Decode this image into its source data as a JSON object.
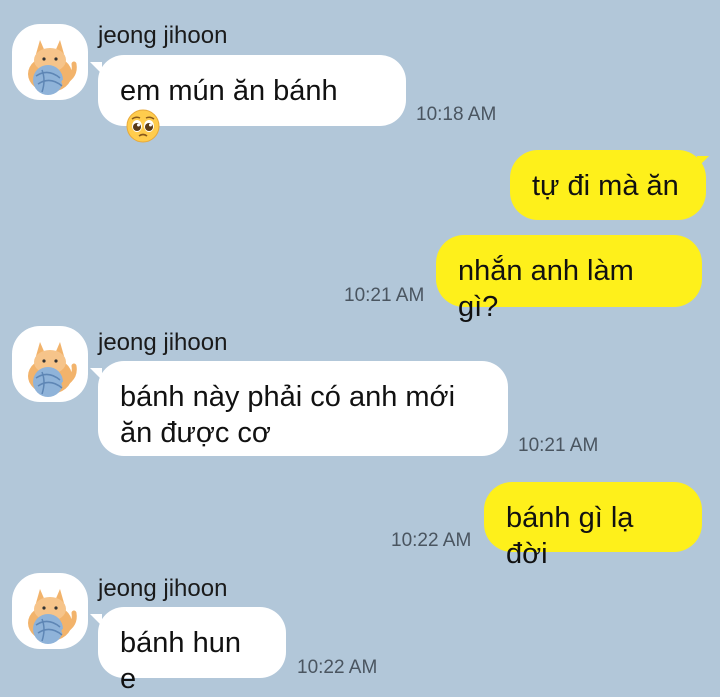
{
  "sender_name": "jeong jihoon",
  "messages": [
    {
      "direction": "in",
      "text": "em mún ăn bánh",
      "emoji": "pleading-face",
      "time": "10:18 AM"
    },
    {
      "direction": "out",
      "text": "tự đi mà ăn",
      "time": ""
    },
    {
      "direction": "out",
      "text": "nhắn anh làm gì?",
      "time": "10:21 AM"
    },
    {
      "direction": "in",
      "text_line1": "bánh này phải có anh mới",
      "text_line2": "ăn được cơ",
      "time": "10:21 AM"
    },
    {
      "direction": "out",
      "text": "bánh gì lạ đời",
      "time": "10:22 AM"
    },
    {
      "direction": "in",
      "text": "bánh hun e",
      "time": "10:22 AM"
    }
  ],
  "colors": {
    "background": "#b2c7d9",
    "incoming_bubble": "#ffffff",
    "outgoing_bubble": "#fef01b",
    "timestamp": "#4a5560"
  }
}
